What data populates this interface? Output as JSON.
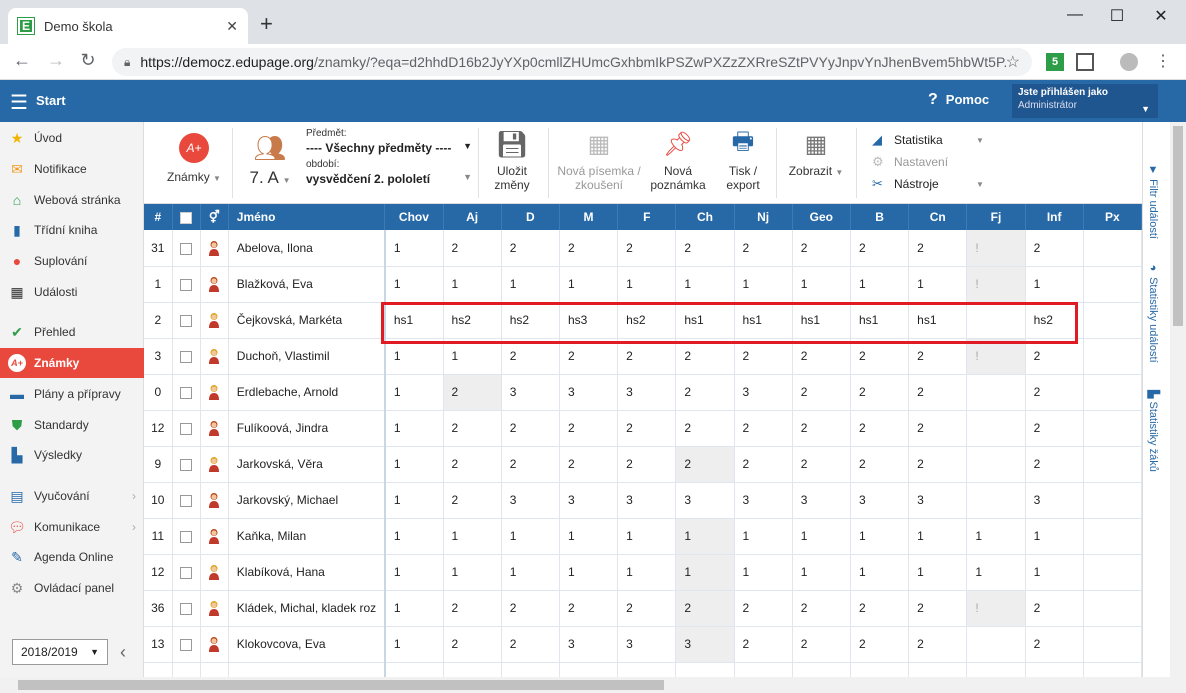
{
  "browser": {
    "tab_title": "Demo škola",
    "favicon_letter": "E",
    "url_host": "https://democz.edupage.org",
    "url_path": "/znamky/?eqa=d2hhdD16b2JyYXp0cmllZHUmcGxhbmIkPSZwPXZzZXRreSZtPVYyJnpvYnJhenBvem5hbWt5P...",
    "ext_badge": "5"
  },
  "header": {
    "start_label": "Start",
    "help_label": "Pomoc",
    "user_line1": "Jste přihlášen jako",
    "user_line2": "Administrátor"
  },
  "sidebar": {
    "items": [
      {
        "label": "Úvod",
        "icon": "star-icon"
      },
      {
        "label": "Notifikace",
        "icon": "envelope-icon"
      },
      {
        "label": "Webová stránka",
        "icon": "house-icon"
      },
      {
        "label": "Třídní kniha",
        "icon": "book-icon"
      },
      {
        "label": "Suplování",
        "icon": "substitute-icon"
      },
      {
        "label": "Události",
        "icon": "calendar-icon"
      },
      {
        "label": "Přehled",
        "icon": "check-circle-icon"
      },
      {
        "label": "Známky",
        "icon": "grade-icon"
      },
      {
        "label": "Plány a přípravy",
        "icon": "briefcase-icon"
      },
      {
        "label": "Standardy",
        "icon": "shield-icon"
      },
      {
        "label": "Výsledky",
        "icon": "bar-chart-icon"
      },
      {
        "label": "Vyučování",
        "icon": "books-icon"
      },
      {
        "label": "Komunikace",
        "icon": "chat-icon"
      },
      {
        "label": "Agenda Online",
        "icon": "pen-icon"
      },
      {
        "label": "Ovládací panel",
        "icon": "gear-icon"
      }
    ],
    "year": "2018/2019"
  },
  "ribbon": {
    "grades_label": "Známky",
    "class_label": "7. A",
    "subject_caption": "Předmět:",
    "subject_value": "---- Všechny předměty ----",
    "period_caption": "období:",
    "period_value": "vysvědčení 2. pololetí",
    "save_label": "Uložit změny",
    "new_test_label": "Nová písemka / zkoušení",
    "new_note_label": "Nová poznámka",
    "print_label": "Tisk / export",
    "view_label": "Zobrazit",
    "stats_label": "Statistika",
    "settings_label": "Nastavení",
    "tools_label": "Nástroje"
  },
  "right_tabs": [
    "Filtr událostí",
    "Statistiky událostí",
    "Statistiky žáků"
  ],
  "table": {
    "col_num": "#",
    "col_name": "Jméno",
    "subjects": [
      "Chov",
      "Aj",
      "D",
      "M",
      "F",
      "Ch",
      "Nj",
      "Geo",
      "B",
      "Cn",
      "Fj",
      "Inf",
      "Px"
    ],
    "rows": [
      {
        "num": "31",
        "name": "Abelova, Ilona",
        "gender": "f",
        "grades": [
          "1",
          "2",
          "2",
          "2",
          "2",
          "2",
          "2",
          "2",
          "2",
          "2",
          "!",
          "2",
          ""
        ]
      },
      {
        "num": "1",
        "name": "Blažková, Eva",
        "gender": "f",
        "grades": [
          "1",
          "1",
          "1",
          "1",
          "1",
          "1",
          "1",
          "1",
          "1",
          "1",
          "!",
          "1",
          ""
        ]
      },
      {
        "num": "2",
        "name": "Čejkovská, Markéta",
        "gender": "m",
        "grades": [
          "hs1",
          "hs2",
          "hs2",
          "hs3",
          "hs2",
          "hs1",
          "hs1",
          "hs1",
          "hs1",
          "hs1",
          "",
          "hs2",
          ""
        ]
      },
      {
        "num": "3",
        "name": "Duchoň, Vlastimil",
        "gender": "m",
        "grades": [
          "1",
          "1",
          "2",
          "2",
          "2",
          "2",
          "2",
          "2",
          "2",
          "2",
          "!",
          "2",
          ""
        ]
      },
      {
        "num": "0",
        "name": "Erdlebache, Arnold",
        "gender": "m",
        "grades": [
          "1",
          "2",
          "3",
          "3",
          "3",
          "2",
          "3",
          "2",
          "2",
          "2",
          "",
          "2",
          ""
        ]
      },
      {
        "num": "12",
        "name": "Fulíkoová, Jindra",
        "gender": "f",
        "grades": [
          "1",
          "2",
          "2",
          "2",
          "2",
          "2",
          "2",
          "2",
          "2",
          "2",
          "",
          "2",
          ""
        ]
      },
      {
        "num": "9",
        "name": "Jarkovská, Věra",
        "gender": "m",
        "grades": [
          "1",
          "2",
          "2",
          "2",
          "2",
          "2",
          "2",
          "2",
          "2",
          "2",
          "",
          "2",
          ""
        ]
      },
      {
        "num": "10",
        "name": "Jarkovský, Michael",
        "gender": "f",
        "grades": [
          "1",
          "2",
          "3",
          "3",
          "3",
          "3",
          "3",
          "3",
          "3",
          "3",
          "",
          "3",
          ""
        ]
      },
      {
        "num": "11",
        "name": "Kaňka, Milan",
        "gender": "f",
        "grades": [
          "1",
          "1",
          "1",
          "1",
          "1",
          "1",
          "1",
          "1",
          "1",
          "1",
          "1",
          "1",
          ""
        ]
      },
      {
        "num": "12",
        "name": "Klabíková, Hana",
        "gender": "m",
        "grades": [
          "1",
          "1",
          "1",
          "1",
          "1",
          "1",
          "1",
          "1",
          "1",
          "1",
          "1",
          "1",
          ""
        ]
      },
      {
        "num": "36",
        "name": "Kládek, Michal, kladek roz",
        "gender": "m",
        "grades": [
          "1",
          "2",
          "2",
          "2",
          "2",
          "2",
          "2",
          "2",
          "2",
          "2",
          "!",
          "2",
          ""
        ]
      },
      {
        "num": "13",
        "name": "Klokovcova, Eva",
        "gender": "f",
        "grades": [
          "1",
          "2",
          "2",
          "3",
          "3",
          "3",
          "2",
          "2",
          "2",
          "2",
          "",
          "2",
          ""
        ]
      },
      {
        "num": "",
        "name": "",
        "gender": "",
        "grades": [
          "",
          "",
          "",
          "",
          "",
          "",
          "",
          "",
          "",
          "",
          "",
          "",
          ""
        ]
      }
    ],
    "shaded": [
      [
        0,
        10
      ],
      [
        1,
        10
      ],
      [
        3,
        10
      ],
      [
        4,
        1
      ],
      [
        6,
        5
      ],
      [
        8,
        5
      ],
      [
        9,
        5
      ],
      [
        10,
        5
      ],
      [
        10,
        10
      ],
      [
        11,
        5
      ]
    ]
  },
  "colors": {
    "brand_blue": "#2769a7",
    "active_red": "#e8493c",
    "highlight_red": "#e01b24"
  }
}
